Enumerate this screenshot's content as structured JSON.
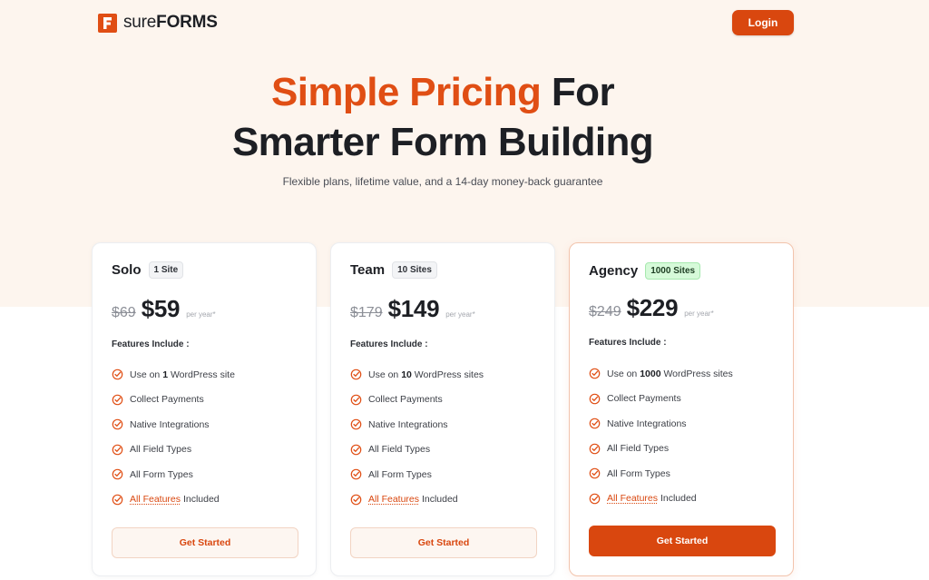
{
  "brand": {
    "logo_light": "sure",
    "logo_bold": "FORMS",
    "accent_color": "#e04e14"
  },
  "header": {
    "login_label": "Login"
  },
  "hero": {
    "title_accent": "Simple Pricing",
    "title_rest_line1": " For",
    "title_line2": "Smarter Form Building",
    "subtitle": "Flexible plans, lifetime value, and a 14-day money-back guarantee"
  },
  "plans": [
    {
      "name": "Solo",
      "badge": "1 Site",
      "old_price": "$69",
      "new_price": "$59",
      "period": "per year*",
      "features_title": "Features Include :",
      "features": [
        {
          "pre": "Use on ",
          "strong": "1",
          "post": " WordPress site"
        },
        {
          "pre": "Collect Payments",
          "strong": "",
          "post": ""
        },
        {
          "pre": "Native Integrations",
          "strong": "",
          "post": ""
        },
        {
          "pre": "All Field Types",
          "strong": "",
          "post": ""
        },
        {
          "pre": "All Form Types",
          "strong": "",
          "post": ""
        }
      ],
      "link_feature": {
        "link": "All Features",
        "post": " Included"
      },
      "cta": "Get Started"
    },
    {
      "name": "Team",
      "badge": "10 Sites",
      "old_price": "$179",
      "new_price": "$149",
      "period": "per year*",
      "features_title": "Features Include :",
      "features": [
        {
          "pre": "Use on ",
          "strong": "10",
          "post": " WordPress sites"
        },
        {
          "pre": "Collect Payments",
          "strong": "",
          "post": ""
        },
        {
          "pre": "Native Integrations",
          "strong": "",
          "post": ""
        },
        {
          "pre": "All Field Types",
          "strong": "",
          "post": ""
        },
        {
          "pre": "All Form Types",
          "strong": "",
          "post": ""
        }
      ],
      "link_feature": {
        "link": "All Features",
        "post": " Included"
      },
      "cta": "Get Started"
    },
    {
      "name": "Agency",
      "badge": "1000 Sites",
      "old_price": "$249",
      "new_price": "$229",
      "period": "per year*",
      "features_title": "Features Include :",
      "features": [
        {
          "pre": "Use on ",
          "strong": "1000",
          "post": " WordPress sites"
        },
        {
          "pre": "Collect Payments",
          "strong": "",
          "post": ""
        },
        {
          "pre": "Native Integrations",
          "strong": "",
          "post": ""
        },
        {
          "pre": "All Field Types",
          "strong": "",
          "post": ""
        },
        {
          "pre": "All Form Types",
          "strong": "",
          "post": ""
        }
      ],
      "link_feature": {
        "link": "All Features",
        "post": " Included"
      },
      "cta": "Get Started"
    }
  ]
}
